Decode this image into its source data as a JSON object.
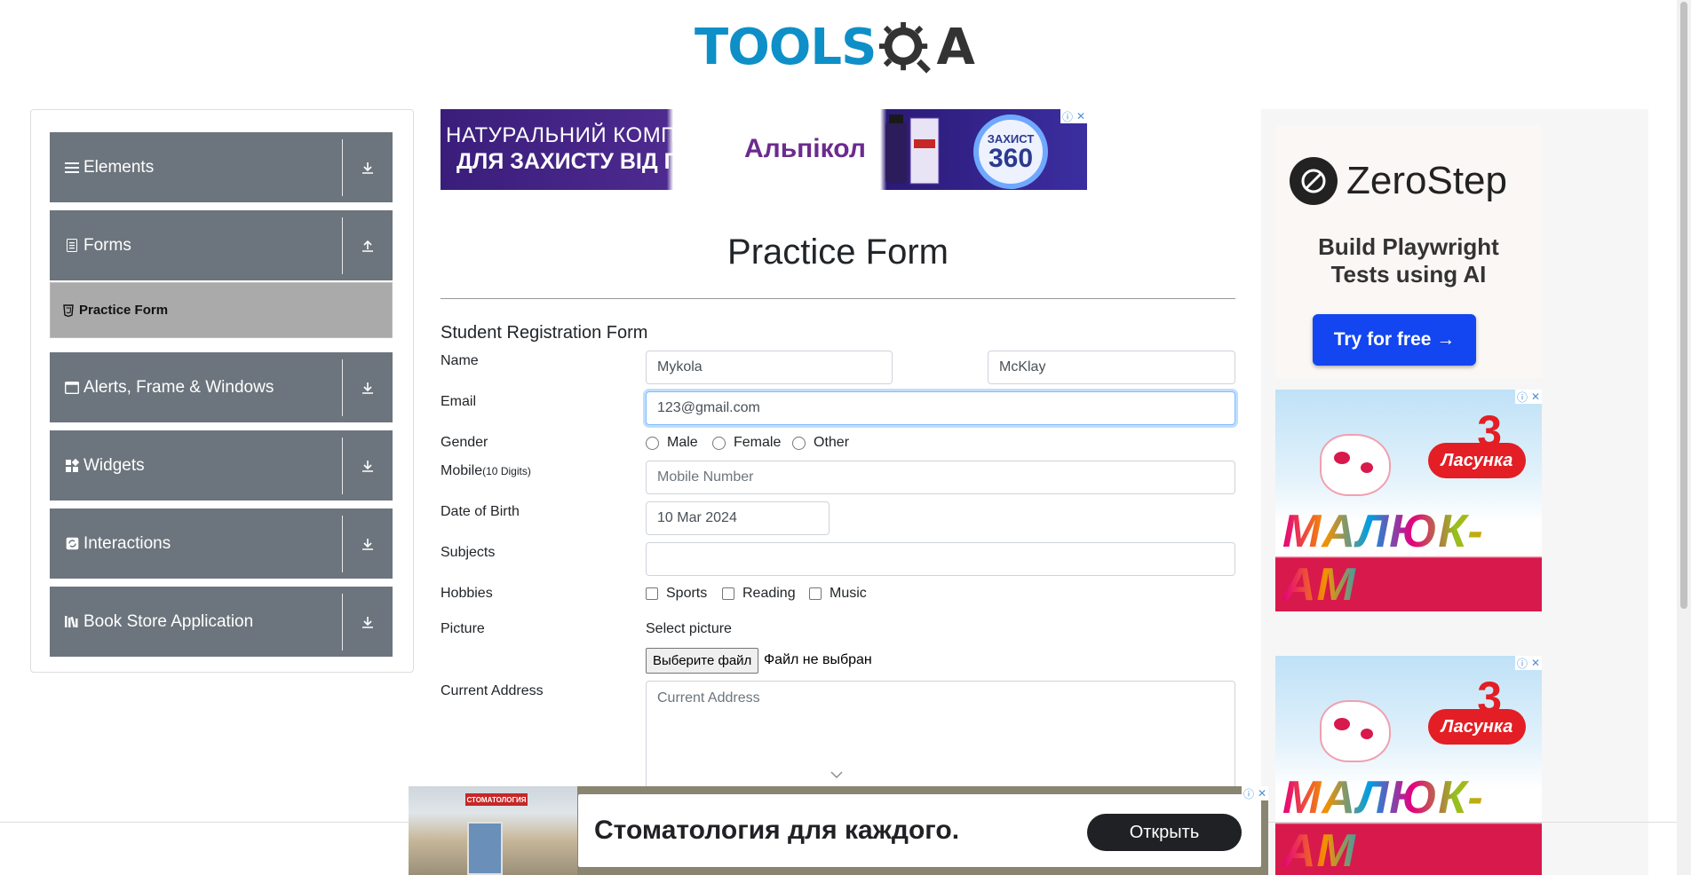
{
  "header": {
    "logo_left": "TOOLS",
    "logo_right": "A"
  },
  "sidebar": {
    "groups": [
      {
        "label": "Elements",
        "icon": "list-icon",
        "arrow": "download-arrow-icon"
      },
      {
        "label": "Forms",
        "icon": "document-icon",
        "arrow": "upload-arrow-icon"
      },
      {
        "label": "Alerts, Frame & Windows",
        "icon": "window-icon",
        "arrow": "download-arrow-icon"
      },
      {
        "label": "Widgets",
        "icon": "widgets-icon",
        "arrow": "download-arrow-icon"
      },
      {
        "label": "Interactions",
        "icon": "refresh-icon",
        "arrow": "download-arrow-icon"
      },
      {
        "label": "Book Store Application",
        "icon": "books-icon",
        "arrow": "download-arrow-icon"
      }
    ],
    "active_item": "Practice Form"
  },
  "ads": {
    "top": {
      "line1": "НАТУРАЛЬНИЙ КОМПЛЕКС",
      "line2": "ДЛЯ ЗАХИСТУ ВІД ГРВІ",
      "brand": "Альпікол",
      "badge_top": "ЗАХИСТ",
      "badge_num": "360"
    },
    "zerostep": {
      "name": "ZeroStep",
      "tagline_1": "Build Playwright",
      "tagline_2": "Tests using AI",
      "button": "Try for free →"
    },
    "lasunka": {
      "brand": "Ласунка",
      "number": "3",
      "product": "МАЛЮК-АМ"
    },
    "bottom": {
      "text": "Стоматология для каждого.",
      "button": "Открыть",
      "sign": "СТОМАТОЛОГИЯ"
    }
  },
  "form": {
    "title": "Practice Form",
    "subtitle": "Student Registration Form",
    "labels": {
      "name": "Name",
      "email": "Email",
      "gender": "Gender",
      "mobile": "Mobile",
      "mobile_hint": "(10 Digits)",
      "dob": "Date of Birth",
      "subjects": "Subjects",
      "hobbies": "Hobbies",
      "picture": "Picture",
      "address": "Current Address"
    },
    "first_name": "Mykola",
    "last_name": "McKlay",
    "email": "123@gmail.com",
    "gender_options": [
      "Male",
      "Female",
      "Other"
    ],
    "mobile_placeholder": "Mobile Number",
    "dob": "10 Mar 2024",
    "subjects": "",
    "hobby_options": [
      "Sports",
      "Reading",
      "Music"
    ],
    "picture_label": "Select picture",
    "file_button": "Выберите файл",
    "file_status": "Файл не выбран",
    "address_placeholder": "Current Address"
  }
}
